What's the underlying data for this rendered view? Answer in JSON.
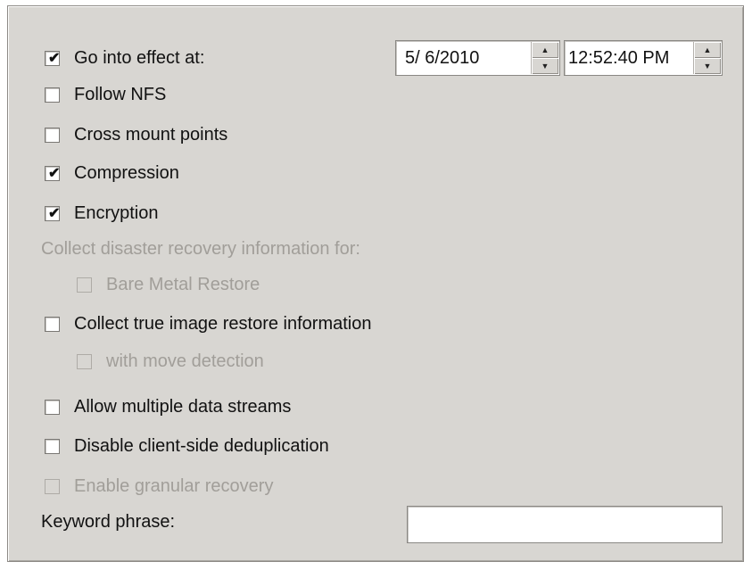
{
  "options": {
    "go_into_effect": {
      "label": "Go into effect at:",
      "checked": true
    },
    "follow_nfs": {
      "label": "Follow NFS",
      "checked": false
    },
    "cross_mount_points": {
      "label": "Cross mount points",
      "checked": false
    },
    "compression": {
      "label": "Compression",
      "checked": true
    },
    "encryption": {
      "label": "Encryption",
      "checked": true
    },
    "dr_info_label": "Collect disaster recovery information for:",
    "bare_metal_restore": {
      "label": "Bare Metal Restore",
      "checked": false,
      "enabled": false
    },
    "collect_true_image": {
      "label": "Collect true image restore information",
      "checked": false
    },
    "with_move_detection": {
      "label": "with move detection",
      "checked": false,
      "enabled": false
    },
    "allow_multiple_streams": {
      "label": "Allow multiple data streams",
      "checked": false
    },
    "disable_dedup": {
      "label": "Disable client-side deduplication",
      "checked": false
    },
    "enable_granular_recovery": {
      "label": "Enable granular recovery",
      "checked": false,
      "enabled": false
    }
  },
  "effective": {
    "date": "5/ 6/2010",
    "time": "12:52:40 PM"
  },
  "keyword": {
    "label": "Keyword phrase:",
    "value": ""
  },
  "glyphs": {
    "check": "✔",
    "spin_up": "▲",
    "spin_down": "▼"
  }
}
